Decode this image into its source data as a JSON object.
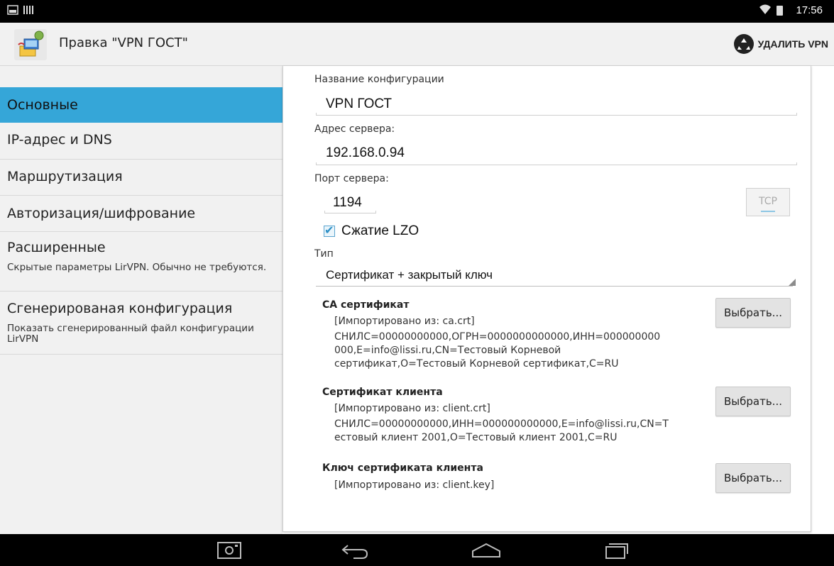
{
  "status": {
    "time": "17:56"
  },
  "actionbar": {
    "title": "Правка \"VPN ГОСТ\"",
    "delete_label": "УДАЛИТЬ VPN"
  },
  "sidebar": {
    "items": [
      {
        "title": "Основные",
        "subtitle": "",
        "selected": true
      },
      {
        "title": "IP-адрес и DNS",
        "subtitle": ""
      },
      {
        "title": "Маршрутизация",
        "subtitle": ""
      },
      {
        "title": "Авторизация/шифрование",
        "subtitle": ""
      },
      {
        "title": "Расширенные",
        "subtitle": "Скрытые параметры LirVPN. Обычно не требуются."
      },
      {
        "title": "Сгенерированая конфигурация",
        "subtitle": "Показать сгенерированный файл конфигурации LirVPN"
      }
    ]
  },
  "form": {
    "config_name_label": "Название конфигурации",
    "config_name_value": "VPN ГОСТ",
    "server_address_label": "Адрес сервера:",
    "server_address_value": "192.168.0.94",
    "server_port_label": "Порт сервера:",
    "server_port_value": "1194",
    "protocol_button": "TCP",
    "lzo_label": "Сжатие LZO",
    "lzo_checked": true,
    "type_label": "Тип",
    "type_value": "Сертификат + закрытый ключ"
  },
  "certs": {
    "ca": {
      "title": "CA сертификат",
      "imported": "[Импортировано из: ca.crt]",
      "detail_1": "СНИЛС=00000000000,ОГРН=0000000000000,ИНН=000000000",
      "detail_2": "000,E=info@lissi.ru,CN=Тестовый Корневой",
      "detail_3": "сертификат,O=Тестовый Корневой сертификат,C=RU",
      "button": "Выбрать..."
    },
    "client": {
      "title": "Сертификат клиента",
      "imported": "[Импортировано из: client.crt]",
      "detail_1": "СНИЛС=00000000000,ИНН=000000000000,E=info@lissi.ru,CN=Т",
      "detail_2": "естовый клиент 2001,O=Тестовый клиент 2001,C=RU",
      "button": "Выбрать..."
    },
    "key": {
      "title": "Ключ сертификата клиента",
      "imported": "[Импортировано из: client.key]",
      "button": "Выбрать..."
    }
  },
  "colors": {
    "selected": "#35a6d8",
    "accent": "#2c8fc6"
  }
}
